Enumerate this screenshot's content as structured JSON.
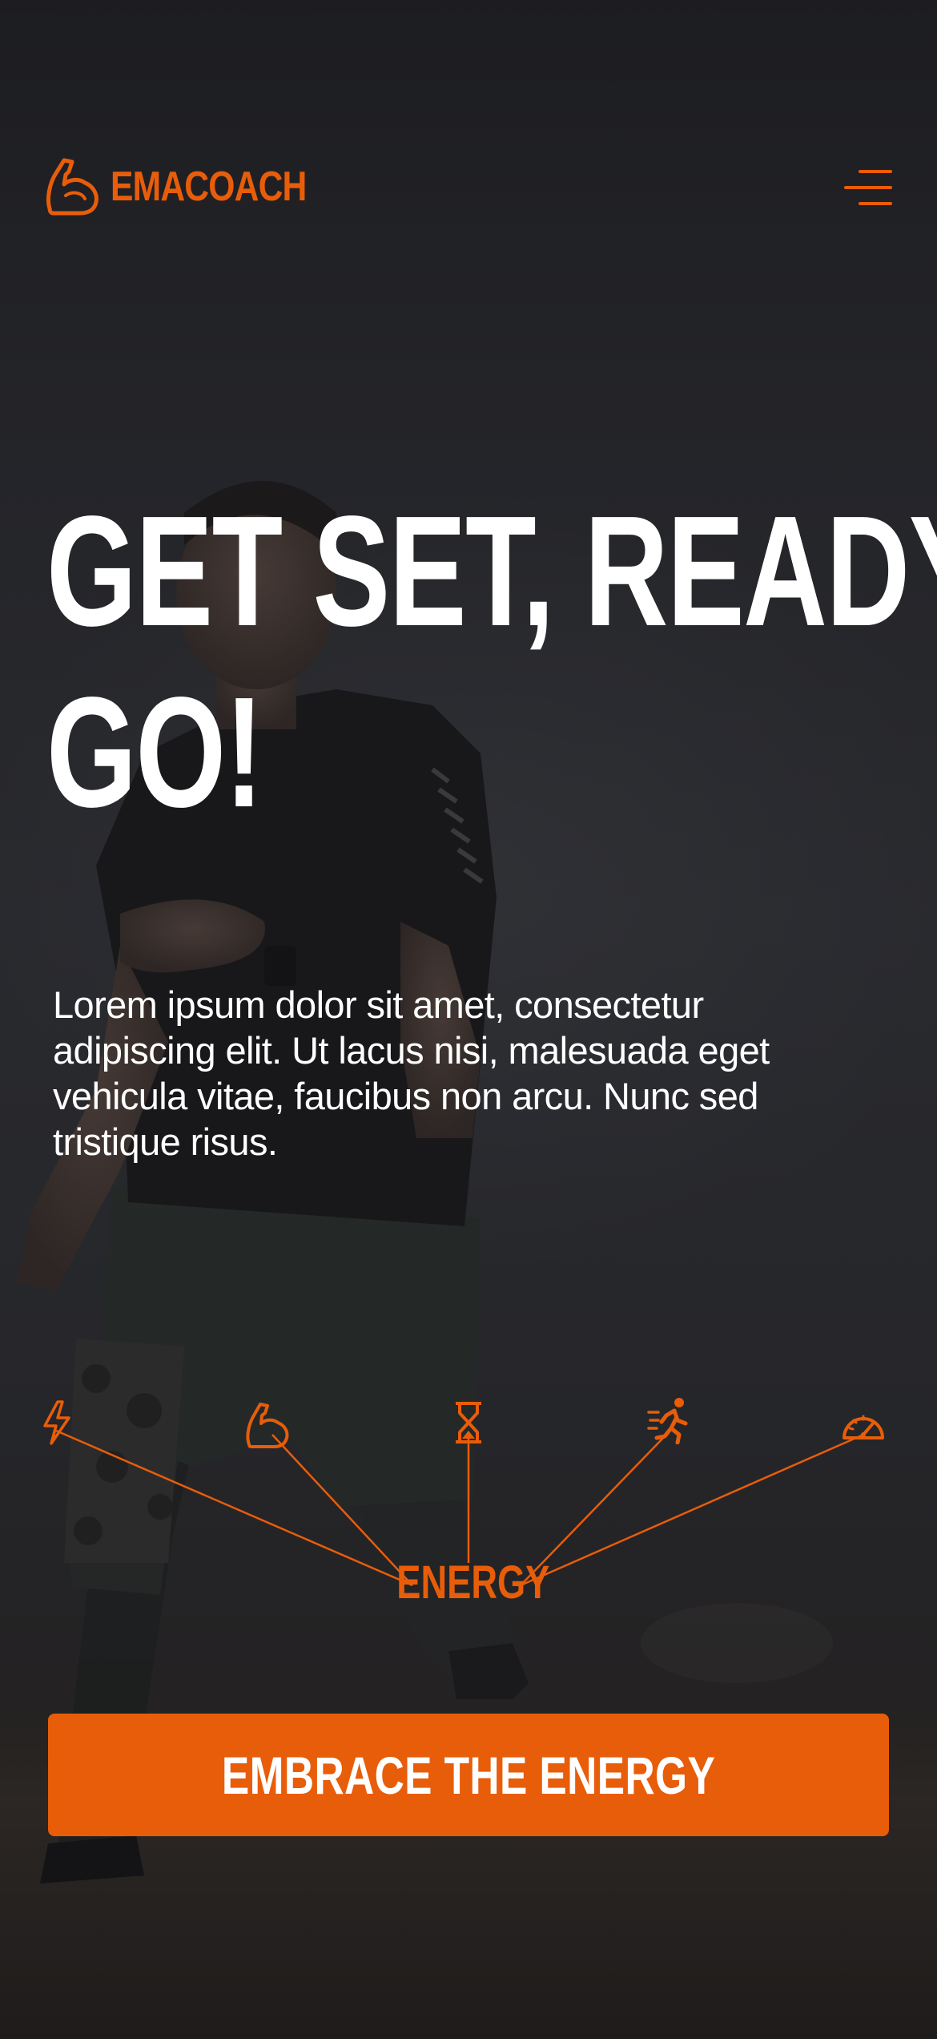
{
  "brand": {
    "name": "EMACOACH",
    "accent_color": "#e85d0a",
    "logo_icon": "flexed-arm-icon"
  },
  "header": {
    "menu_icon": "hamburger-menu-icon"
  },
  "hero": {
    "headline_line1": "GET SET, READY,",
    "headline_line2": "GO!",
    "description": "Lorem ipsum dolor sit amet, consectetur adipiscing elit. Ut lacus nisi, malesuada eget vehicula vitae, faucibus non arcu. Nunc sed tristique risus.",
    "background_image": "runner-photo"
  },
  "energy_diagram": {
    "center_label": "ENERGY",
    "icons": [
      "lightning-icon",
      "flexed-arm-icon",
      "hourglass-icon",
      "running-person-icon",
      "speedometer-icon"
    ]
  },
  "cta": {
    "label": "EMBRACE THE ENERGY"
  }
}
